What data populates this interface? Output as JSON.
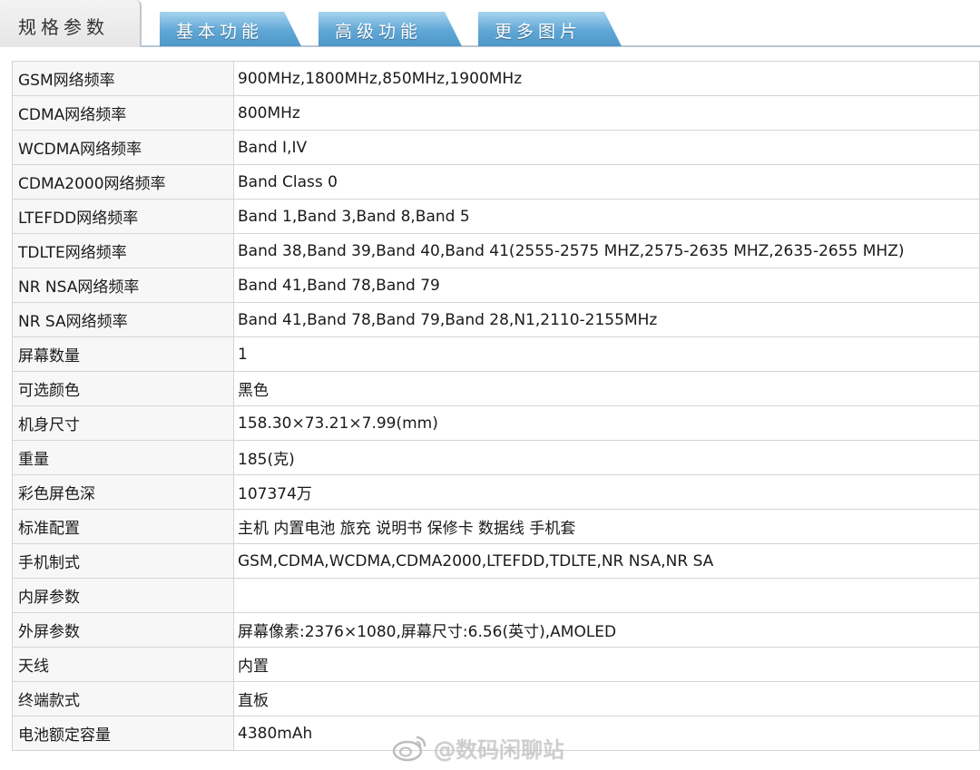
{
  "tabs": {
    "active": "规格参数",
    "basic": "基本功能",
    "advanced": "高级功能",
    "more_images": "更多图片"
  },
  "specs": [
    {
      "label": "GSM网络频率",
      "value": "900MHz,1800MHz,850MHz,1900MHz"
    },
    {
      "label": "CDMA网络频率",
      "value": "800MHz"
    },
    {
      "label": "WCDMA网络频率",
      "value": "Band I,IV"
    },
    {
      "label": "CDMA2000网络频率",
      "value": "Band Class 0"
    },
    {
      "label": "LTEFDD网络频率",
      "value": "Band 1,Band 3,Band 8,Band 5"
    },
    {
      "label": "TDLTE网络频率",
      "value": "Band 38,Band 39,Band 40,Band 41(2555-2575 MHZ,2575-2635 MHZ,2635-2655 MHZ)"
    },
    {
      "label": "NR NSA网络频率",
      "value": "Band 41,Band 78,Band 79"
    },
    {
      "label": "NR SA网络频率",
      "value": "Band 41,Band 78,Band 79,Band 28,N1,2110-2155MHz"
    },
    {
      "label": "屏幕数量",
      "value": "1"
    },
    {
      "label": "可选颜色",
      "value": "黑色"
    },
    {
      "label": "机身尺寸",
      "value": "158.30×73.21×7.99(mm)"
    },
    {
      "label": "重量",
      "value": "185(克)"
    },
    {
      "label": "彩色屏色深",
      "value": "107374万"
    },
    {
      "label": "标准配置",
      "value": "主机 内置电池 旅充 说明书 保修卡 数据线 手机套"
    },
    {
      "label": "手机制式",
      "value": "GSM,CDMA,WCDMA,CDMA2000,LTEFDD,TDLTE,NR NSA,NR SA"
    },
    {
      "label": "内屏参数",
      "value": ""
    },
    {
      "label": "外屏参数",
      "value": "屏幕像素:2376×1080,屏幕尺寸:6.56(英寸),AMOLED"
    },
    {
      "label": "天线",
      "value": "内置"
    },
    {
      "label": "终端款式",
      "value": "直板"
    },
    {
      "label": "电池额定容量",
      "value": "4380mAh"
    }
  ],
  "watermark": {
    "text": "@数码闲聊站",
    "icon": "weibo-icon"
  },
  "colors": {
    "tab_blue": "#5fa7d6",
    "label_bg": "#f7f7f7",
    "border": "#d4d4d4"
  }
}
